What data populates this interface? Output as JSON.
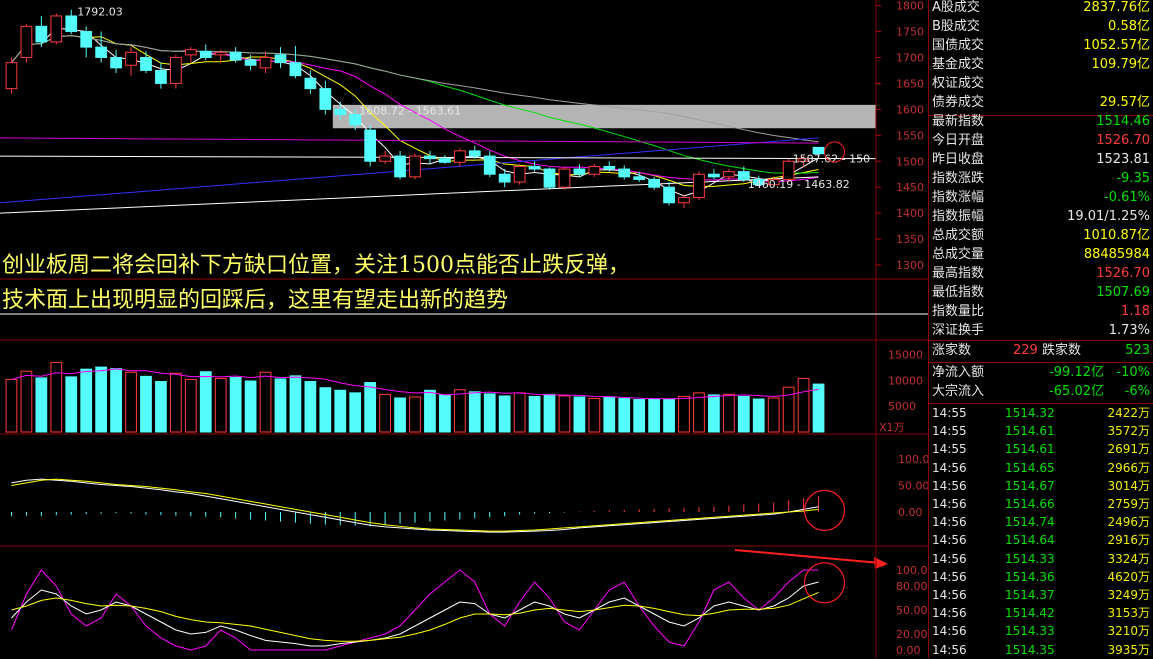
{
  "right_panel": {
    "stats": [
      {
        "label": "A股成交",
        "value": "2837.76亿",
        "color": "#ffff00"
      },
      {
        "label": "B股成交",
        "value": "0.58亿",
        "color": "#ffff00"
      },
      {
        "label": "国债成交",
        "value": "1052.57亿",
        "color": "#ffff00"
      },
      {
        "label": "基金成交",
        "value": "109.79亿",
        "color": "#ffff00"
      },
      {
        "label": "权证成交",
        "value": "",
        "color": "#ffff00"
      },
      {
        "label": "债券成交",
        "value": "29.57亿",
        "color": "#ffff00"
      },
      {
        "label": "最新指数",
        "value": "1514.46",
        "color": "#00e000"
      },
      {
        "label": "今日开盘",
        "value": "1526.70",
        "color": "#ff3c3c"
      },
      {
        "label": "昨日收盘",
        "value": "1523.81",
        "color": "#e6e6e6"
      },
      {
        "label": "指数涨跌",
        "value": "-9.35",
        "color": "#00e000"
      },
      {
        "label": "指数涨幅",
        "value": "-0.61%",
        "color": "#00e000"
      },
      {
        "label": "指数振幅",
        "value": "19.01/1.25%",
        "color": "#e6e6e6"
      },
      {
        "label": "总成交额",
        "value": "1010.87亿",
        "color": "#ffff00"
      },
      {
        "label": "总成交量",
        "value": "88485984",
        "color": "#ffff00"
      },
      {
        "label": "最高指数",
        "value": "1526.70",
        "color": "#ff3c3c"
      },
      {
        "label": "最低指数",
        "value": "1507.69",
        "color": "#00e000"
      },
      {
        "label": "指数量比",
        "value": "1.18",
        "color": "#ff3c3c"
      },
      {
        "label": "深证换手",
        "value": "1.73%",
        "color": "#e6e6e6"
      }
    ],
    "breadth": {
      "up_label": "涨家数",
      "up_value": "229",
      "down_label": "跌家数",
      "down_value": "523"
    },
    "flows": [
      {
        "label": "净流入额",
        "value": "-99.12亿",
        "pct": "-10%"
      },
      {
        "label": "大宗流入",
        "value": "-65.02亿",
        "pct": "-6%"
      }
    ],
    "ticks": [
      {
        "time": "14:55",
        "price": "1514.32",
        "vol": "2422万"
      },
      {
        "time": "14:55",
        "price": "1514.61",
        "vol": "3572万"
      },
      {
        "time": "14:55",
        "price": "1514.61",
        "vol": "2691万"
      },
      {
        "time": "14:56",
        "price": "1514.65",
        "vol": "2966万"
      },
      {
        "time": "14:56",
        "price": "1514.67",
        "vol": "3014万"
      },
      {
        "time": "14:56",
        "price": "1514.66",
        "vol": "2759万"
      },
      {
        "time": "14:56",
        "price": "1514.74",
        "vol": "2496万"
      },
      {
        "time": "14:56",
        "price": "1514.64",
        "vol": "2916万"
      },
      {
        "time": "14:56",
        "price": "1514.33",
        "vol": "3324万"
      },
      {
        "time": "14:56",
        "price": "1514.36",
        "vol": "4620万"
      },
      {
        "time": "14:56",
        "price": "1514.37",
        "vol": "3249万"
      },
      {
        "time": "14:56",
        "price": "1514.42",
        "vol": "3153万"
      },
      {
        "time": "14:56",
        "price": "1514.33",
        "vol": "3210万"
      },
      {
        "time": "14:56",
        "price": "1514.35",
        "vol": "3935万"
      }
    ]
  },
  "overlay_text": {
    "line1": "创业板周二将会回补下方缺口位置，关注1500点能否止跌反弹，",
    "line2": "技术面上出现明显的回踩后，这里有望走出新的趋势"
  },
  "colors": {
    "up": "#ff3c3c",
    "down": "#54fcfc",
    "ma5": "#ffffff",
    "ma10": "#ffff00",
    "ma20": "#ff00ff",
    "ma60": "#00e000",
    "ma120": "#a0a0a0",
    "ma250": "#3030ff"
  },
  "chart_data": {
    "type": "candlestick",
    "price_axis_ticks": [
      "1800",
      "1750",
      "1700",
      "1650",
      "1600",
      "1550",
      "1500",
      "1450",
      "1400",
      "1350",
      "1300"
    ],
    "volume_axis_ticks": [
      "15000",
      "10000",
      "5000"
    ],
    "volume_unit": "X1万",
    "macd_axis_ticks": [
      "100.0",
      "50.00",
      "0.00"
    ],
    "kdj_axis_ticks": [
      "100.00",
      "80.00",
      "50.00",
      "20.00",
      "0.00"
    ],
    "annotations": {
      "high": "1792.03",
      "gap_upper": "1608.72 - 1563.61",
      "gap_mid": "1507.62 - 150",
      "gap_lower": "1460.19 - 1463.82"
    },
    "gap_zone": [
      1563.61,
      1608.72
    ],
    "candles": [
      [
        1640,
        1700,
        1630,
        1690
      ],
      [
        1700,
        1765,
        1690,
        1760
      ],
      [
        1760,
        1780,
        1720,
        1730
      ],
      [
        1730,
        1785,
        1725,
        1780
      ],
      [
        1780,
        1792.03,
        1745,
        1750
      ],
      [
        1750,
        1760,
        1700,
        1720
      ],
      [
        1720,
        1750,
        1690,
        1700
      ],
      [
        1700,
        1715,
        1670,
        1680
      ],
      [
        1685,
        1720,
        1665,
        1710
      ],
      [
        1700,
        1712,
        1670,
        1675
      ],
      [
        1675,
        1690,
        1640,
        1650
      ],
      [
        1650,
        1705,
        1640,
        1700
      ],
      [
        1705,
        1720,
        1690,
        1715
      ],
      [
        1712,
        1725,
        1695,
        1700
      ],
      [
        1705,
        1715,
        1690,
        1710
      ],
      [
        1710,
        1720,
        1690,
        1695
      ],
      [
        1695,
        1705,
        1675,
        1685
      ],
      [
        1680,
        1712,
        1670,
        1700
      ],
      [
        1705,
        1720,
        1680,
        1690
      ],
      [
        1690,
        1722,
        1660,
        1665
      ],
      [
        1660,
        1675,
        1630,
        1640
      ],
      [
        1640,
        1655,
        1590,
        1600
      ],
      [
        1600,
        1615,
        1580,
        1590
      ],
      [
        1590,
        1600,
        1560,
        1570
      ],
      [
        1560,
        1570,
        1490,
        1500
      ],
      [
        1500,
        1520,
        1495,
        1510
      ],
      [
        1510,
        1520,
        1465,
        1470
      ],
      [
        1470,
        1515,
        1465,
        1510
      ],
      [
        1510,
        1520,
        1495,
        1505
      ],
      [
        1505,
        1512,
        1495,
        1498
      ],
      [
        1498,
        1525,
        1490,
        1520
      ],
      [
        1520,
        1530,
        1505,
        1510
      ],
      [
        1510,
        1520,
        1470,
        1475
      ],
      [
        1475,
        1485,
        1450,
        1460
      ],
      [
        1460,
        1495,
        1455,
        1490
      ],
      [
        1490,
        1500,
        1480,
        1485
      ],
      [
        1485,
        1488,
        1445,
        1450
      ],
      [
        1450,
        1490,
        1445,
        1485
      ],
      [
        1485,
        1495,
        1470,
        1475
      ],
      [
        1475,
        1495,
        1470,
        1490
      ],
      [
        1490,
        1500,
        1480,
        1485
      ],
      [
        1485,
        1492,
        1465,
        1470
      ],
      [
        1470,
        1480,
        1460,
        1465
      ],
      [
        1465,
        1470,
        1445,
        1450
      ],
      [
        1450,
        1460,
        1415,
        1420
      ],
      [
        1420,
        1435,
        1410,
        1430
      ],
      [
        1430,
        1480,
        1425,
        1475
      ],
      [
        1475,
        1485,
        1465,
        1470
      ],
      [
        1470,
        1485,
        1462,
        1480
      ],
      [
        1480,
        1490,
        1460,
        1465
      ],
      [
        1465,
        1472,
        1452,
        1455
      ],
      [
        1455,
        1470,
        1450,
        1465
      ],
      [
        1465,
        1505,
        1460,
        1500
      ],
      [
        1500,
        1510,
        1490,
        1505
      ],
      [
        1526.7,
        1526.7,
        1507.69,
        1514.46
      ]
    ],
    "volumes": [
      10200,
      11800,
      10500,
      13500,
      10700,
      12200,
      12600,
      12300,
      11600,
      10800,
      9800,
      11400,
      10200,
      11700,
      10400,
      10600,
      9900,
      11600,
      10300,
      10900,
      9800,
      8600,
      8100,
      7600,
      9600,
      7300,
      6600,
      6800,
      8100,
      7200,
      8200,
      7800,
      7400,
      7000,
      7600,
      6900,
      7300,
      7000,
      6800,
      6500,
      6700,
      6500,
      6300,
      6400,
      6400,
      6900,
      7600,
      7200,
      7300,
      6900,
      6400,
      6600,
      8700,
      10400,
      9300
    ],
    "macd_hist": [
      -8,
      -7,
      -8,
      -6,
      -5,
      -4,
      -3,
      -2,
      -3,
      -5,
      -6,
      -7,
      -8,
      -9,
      -10,
      -12,
      -14,
      -16,
      -18,
      -20,
      -22,
      -24,
      -25,
      -26,
      -27,
      -25,
      -22,
      -20,
      -18,
      -16,
      -14,
      -12,
      -10,
      -8,
      -5,
      -3,
      -2,
      -1,
      1,
      2,
      3,
      4,
      5,
      6,
      7,
      8,
      9,
      10,
      12,
      14,
      16,
      18,
      22,
      26,
      30
    ],
    "macd_dif": [
      55,
      60,
      62,
      60,
      58,
      55,
      52,
      50,
      48,
      45,
      42,
      38,
      35,
      30,
      25,
      20,
      15,
      10,
      5,
      0,
      -5,
      -10,
      -15,
      -20,
      -25,
      -28,
      -30,
      -32,
      -34,
      -35,
      -36,
      -37,
      -38,
      -38,
      -37,
      -36,
      -35,
      -33,
      -30,
      -28,
      -26,
      -24,
      -22,
      -20,
      -18,
      -16,
      -14,
      -12,
      -10,
      -8,
      -6,
      -4,
      0,
      5,
      10
    ],
    "macd_dea": [
      50,
      55,
      60,
      62,
      60,
      58,
      55,
      52,
      50,
      48,
      45,
      42,
      38,
      35,
      30,
      25,
      20,
      15,
      10,
      5,
      0,
      -5,
      -10,
      -15,
      -20,
      -24,
      -27,
      -30,
      -32,
      -33,
      -34,
      -35,
      -36,
      -36,
      -35,
      -34,
      -32,
      -30,
      -28,
      -26,
      -24,
      -22,
      -20,
      -18,
      -16,
      -14,
      -12,
      -10,
      -8,
      -6,
      -4,
      -2,
      0,
      2,
      5
    ],
    "kdj_k": [
      40,
      60,
      75,
      70,
      55,
      45,
      50,
      60,
      55,
      45,
      35,
      25,
      20,
      22,
      30,
      25,
      18,
      12,
      10,
      8,
      5,
      5,
      8,
      10,
      12,
      15,
      20,
      30,
      40,
      50,
      60,
      58,
      45,
      40,
      50,
      60,
      55,
      45,
      40,
      50,
      60,
      65,
      55,
      45,
      35,
      30,
      40,
      55,
      60,
      55,
      50,
      55,
      65,
      80,
      85
    ],
    "kdj_d": [
      50,
      55,
      62,
      65,
      62,
      58,
      55,
      56,
      55,
      52,
      48,
      42,
      38,
      35,
      34,
      32,
      30,
      26,
      22,
      18,
      14,
      12,
      11,
      11,
      12,
      14,
      16,
      20,
      25,
      32,
      40,
      45,
      45,
      44,
      46,
      50,
      52,
      50,
      48,
      50,
      53,
      56,
      55,
      52,
      48,
      44,
      43,
      46,
      50,
      51,
      51,
      52,
      56,
      64,
      72
    ],
    "kdj_j": [
      25,
      70,
      100,
      80,
      45,
      30,
      40,
      70,
      55,
      30,
      15,
      5,
      0,
      5,
      25,
      15,
      0,
      0,
      0,
      0,
      0,
      0,
      5,
      10,
      15,
      20,
      30,
      50,
      70,
      85,
      100,
      85,
      45,
      30,
      60,
      85,
      65,
      35,
      25,
      50,
      75,
      85,
      55,
      30,
      10,
      5,
      35,
      75,
      85,
      65,
      50,
      65,
      85,
      100,
      100
    ]
  }
}
